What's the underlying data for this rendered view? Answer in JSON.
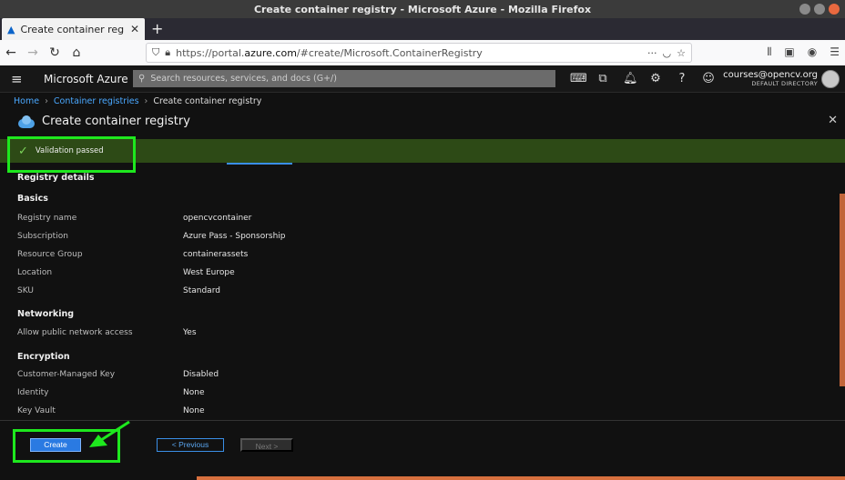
{
  "window": {
    "title": "Create container registry - Microsoft Azure - Mozilla Firefox"
  },
  "browser": {
    "tab_title": "Create container registry",
    "url_prefix": "https://portal.",
    "url_domain": "azure.com",
    "url_rest": "/#create/Microsoft.ContainerRegistry",
    "page_actions": "···"
  },
  "azure": {
    "brand": "Microsoft Azure",
    "search_placeholder": "Search resources, services, and docs (G+/)",
    "account_email": "courses@opencv.org",
    "account_directory": "DEFAULT DIRECTORY"
  },
  "breadcrumb": {
    "home": "Home",
    "registries": "Container registries",
    "current": "Create container registry"
  },
  "blade": {
    "title": "Create container registry",
    "validation": "Validation passed"
  },
  "review": {
    "heading": "Registry details",
    "basics": {
      "title": "Basics",
      "rows": [
        {
          "key": "Registry name",
          "value": "opencvcontainer"
        },
        {
          "key": "Subscription",
          "value": "Azure Pass - Sponsorship"
        },
        {
          "key": "Resource Group",
          "value": "containerassets"
        },
        {
          "key": "Location",
          "value": "West Europe"
        },
        {
          "key": "SKU",
          "value": "Standard"
        }
      ]
    },
    "networking": {
      "title": "Networking",
      "rows": [
        {
          "key": "Allow public network access",
          "value": "Yes"
        }
      ]
    },
    "encryption": {
      "title": "Encryption",
      "rows": [
        {
          "key": "Customer-Managed Key",
          "value": "Disabled"
        },
        {
          "key": "Identity",
          "value": "None"
        },
        {
          "key": "Key Vault",
          "value": "None"
        }
      ]
    }
  },
  "footer": {
    "create": "Create",
    "previous": "< Previous",
    "next": "Next >"
  },
  "colors": {
    "success_banner": "#2d4a16",
    "highlight": "#1ee81e",
    "primary": "#2a7ae2",
    "link": "#4aa8ff"
  }
}
